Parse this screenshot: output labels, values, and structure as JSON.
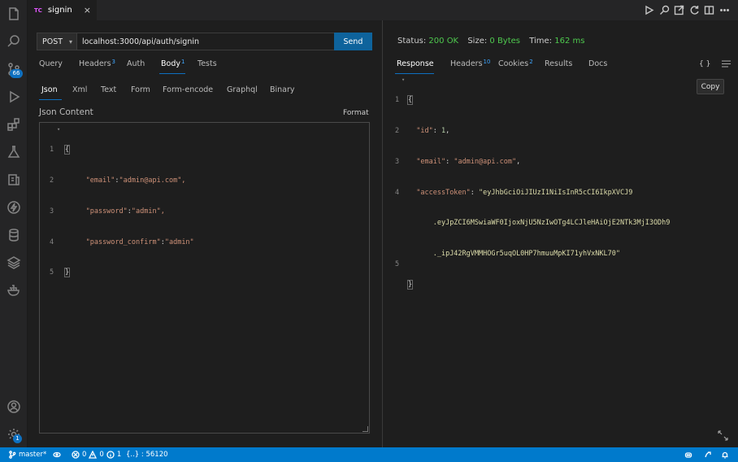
{
  "editor_tab": {
    "badge": "TC",
    "title": "signin",
    "close": "×"
  },
  "activity_bar": {
    "source_control_badge": "66",
    "settings_badge": "1",
    "icons": [
      "files-icon",
      "search-icon",
      "source-control-icon",
      "run-debug-icon",
      "extensions-icon",
      "flask-icon",
      "thunder-client-icon",
      "lightning-icon",
      "database-icon",
      "layers-icon",
      "docker-icon",
      "account-icon",
      "settings-gear-icon"
    ]
  },
  "request": {
    "method": "POST",
    "url": "localhost:3000/api/auth/signin",
    "send_label": "Send",
    "tabs": [
      {
        "label": "Query",
        "count": ""
      },
      {
        "label": "Headers",
        "count": "3"
      },
      {
        "label": "Auth",
        "count": ""
      },
      {
        "label": "Body",
        "count": "1"
      },
      {
        "label": "Tests",
        "count": ""
      }
    ],
    "active_tab": "Body",
    "body_types": [
      "Json",
      "Xml",
      "Text",
      "Form",
      "Form-encode",
      "Graphql",
      "Binary"
    ],
    "active_body_type": "Json",
    "content_label": "Json Content",
    "format_label": "Format",
    "body_lines": [
      {
        "n": "1",
        "text": "{"
      },
      {
        "n": "2",
        "k": "\"email\"",
        "v": "\"admin@api.com\","
      },
      {
        "n": "3",
        "k": "\"password\"",
        "v": "\"admin\","
      },
      {
        "n": "4",
        "k": "\"password_confirm\"",
        "v": "\"admin\""
      },
      {
        "n": "5",
        "text": "}"
      }
    ]
  },
  "response": {
    "status_label": "Status:",
    "status_value": "200 OK",
    "size_label": "Size:",
    "size_value": "0 Bytes",
    "time_label": "Time:",
    "time_value": "162 ms",
    "tabs": [
      {
        "label": "Response",
        "count": ""
      },
      {
        "label": "Headers",
        "count": "10"
      },
      {
        "label": "Cookies",
        "count": "2"
      },
      {
        "label": "Results",
        "count": ""
      },
      {
        "label": "Docs",
        "count": ""
      }
    ],
    "active_tab": "Response",
    "braces_label": "{ }",
    "copy_label": "Copy",
    "line_numbers": [
      "1",
      "2",
      "3",
      "4",
      "",
      "",
      "5"
    ],
    "open_brace": "{",
    "id_key": "\"id\"",
    "id_value": "1",
    "email_key": "\"email\"",
    "email_value": "\"admin@api.com\"",
    "token_key": "\"accessToken\"",
    "token_parts": [
      "\"eyJhbGciOiJIUzI1NiIsInR5cCI6IkpXVCJ9",
      ".eyJpZCI6MSwiaWF0IjoxNjU5NzIwOTg4LCJleHAiOjE2NTk3MjI3ODh9",
      "._ipJ42RgVMMHOGr5uqOL0HP7hmuuMpKI71yhVxNKL70\""
    ],
    "close_brace": "}"
  },
  "status_bar": {
    "branch": "master*",
    "errors": "0",
    "warnings": "0",
    "info": "1",
    "language": "{..} : 56120"
  },
  "colors": {
    "accent": "#007acc",
    "status_ok": "#4ec94e",
    "send_button": "#0e639c"
  }
}
